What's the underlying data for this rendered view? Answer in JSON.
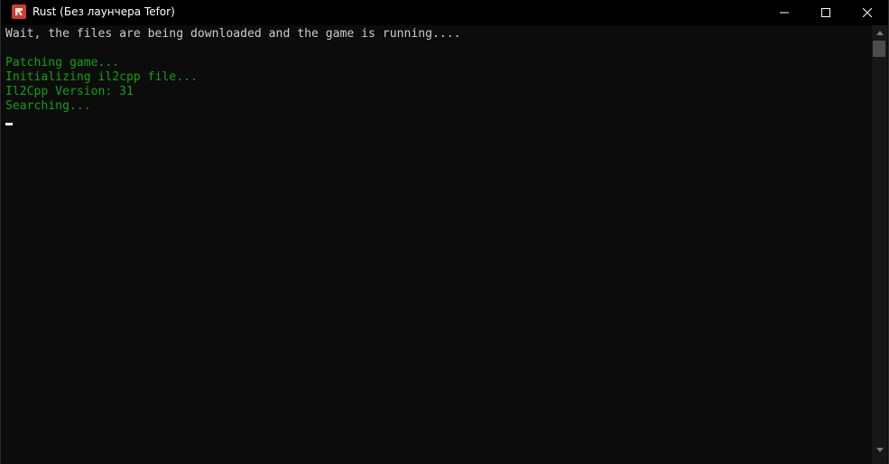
{
  "window": {
    "title": "Rust (Без лаунчера Tefor)",
    "icon": "rust-app-icon",
    "buttons": {
      "minimize": "minimize-icon",
      "maximize": "maximize-icon",
      "close": "close-icon"
    }
  },
  "console": {
    "lines": [
      {
        "text": "Wait, the files are being downloaded and the game is running....",
        "color": "#cccccc"
      },
      {
        "text": "",
        "color": "#cccccc"
      },
      {
        "text": "Patching game...",
        "color": "#13a10e"
      },
      {
        "text": "Initializing il2cpp file...",
        "color": "#13a10e"
      },
      {
        "text": "Il2Cpp Version: 31",
        "color": "#13a10e"
      },
      {
        "text": "Searching...",
        "color": "#13a10e"
      }
    ],
    "background": "#0c0c0c"
  }
}
